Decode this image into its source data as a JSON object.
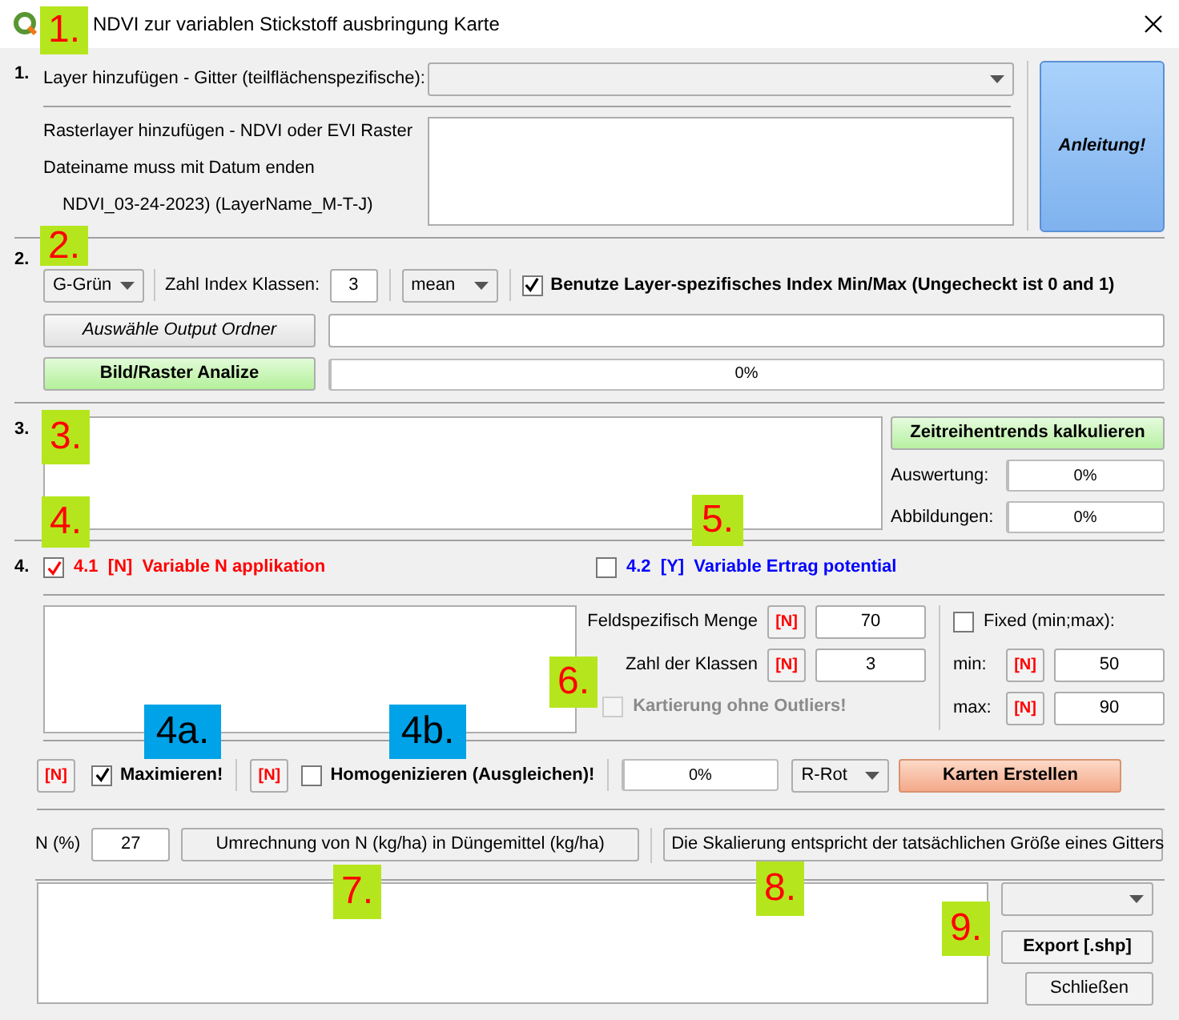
{
  "window": {
    "title": "NDVI zur variablen Stickstoff ausbringung Karte"
  },
  "section1": {
    "number": "1.",
    "layer_label": "Layer hinzufügen - Gitter (teilflächenspezifische):",
    "raster_lines": [
      "Rasterlayer hinzufügen - NDVI oder EVI Raster",
      "Dateiname muss mit Datum enden",
      "NDVI_03-24-2023) (LayerName_M-T-J)"
    ],
    "guide_button": "Anleitung!"
  },
  "section2": {
    "number": "2.",
    "band": "G-Grün",
    "classes_label": "Zahl Index Klassen:",
    "classes": "3",
    "stat": "mean",
    "minmax": {
      "label": "Benutze Layer-spezifisches Index Min/Max (Ungecheckt ist 0 and 1)",
      "checked": true
    },
    "output_button": "Auswähle Output Ordner",
    "analyze_button": "Bild/Raster Analize",
    "progress": {
      "level": 0,
      "reading": "0%"
    }
  },
  "section3": {
    "number": "3.",
    "trend_button": "Zeitreihentrends kalkulieren",
    "rows": [
      {
        "label": "Auswertung:",
        "level": 0,
        "reading": "0%"
      },
      {
        "label": "Abbildungen:",
        "level": 0,
        "reading": "0%"
      }
    ]
  },
  "section4": {
    "number": "4.",
    "options": [
      {
        "code": "4.1",
        "flag": "[N]",
        "label": "Variable N applikation",
        "checked": true,
        "color": "#ff0000"
      },
      {
        "code": "4.2",
        "flag": "[Y]",
        "label": "Variable Ertrag potential",
        "checked": false,
        "color": "#0000ff"
      }
    ],
    "fields": [
      {
        "label": "Feldspezifisch Menge",
        "flag": "[N]",
        "value": "70"
      },
      {
        "label": "Zahl der Klassen",
        "flag": "[N]",
        "value": "3"
      }
    ],
    "outliers": {
      "label": "Kartierung ohne Outliers!",
      "checked": false,
      "disabled": true
    },
    "fixed": {
      "label": "Fixed (min;max):",
      "checked": false
    },
    "limits": [
      {
        "label": "min:",
        "flag": "[N]",
        "value": "50"
      },
      {
        "label": "max:",
        "flag": "[N]",
        "value": "90"
      }
    ],
    "maximize": {
      "flag": "[N]",
      "label": "Maximieren!",
      "checked": true
    },
    "homogenize": {
      "flag": "[N]",
      "label": "Homogenizieren (Ausgleichen)!",
      "checked": false
    },
    "progress": {
      "level": 0,
      "reading": "0%"
    },
    "palette": "R-Rot",
    "create_button": "Karten Erstellen"
  },
  "section5": {
    "n_label": "N (%)",
    "n_value": "27",
    "convert_button": "Umrechnung von N (kg/ha) in Düngemittel (kg/ha)",
    "scale_button": "Die Skalierung entspricht der tatsächlichen Größe eines Gitters"
  },
  "section6": {
    "export_button": "Export [.shp]",
    "close_button": "Schließen"
  },
  "annotations": [
    {
      "label": "1.",
      "kind": "main",
      "color": "#b5e61d"
    },
    {
      "label": "2.",
      "kind": "main",
      "color": "#b5e61d"
    },
    {
      "label": "3.",
      "kind": "main",
      "color": "#b5e61d"
    },
    {
      "label": "4.",
      "kind": "main",
      "color": "#b5e61d"
    },
    {
      "label": "5.",
      "kind": "main",
      "color": "#b5e61d"
    },
    {
      "label": "6.",
      "kind": "main",
      "color": "#b5e61d"
    },
    {
      "label": "4a.",
      "kind": "sub",
      "color": "#00a2e8"
    },
    {
      "label": "4b.",
      "kind": "sub",
      "color": "#00a2e8"
    },
    {
      "label": "7.",
      "kind": "main",
      "color": "#b5e61d"
    },
    {
      "label": "8.",
      "kind": "main",
      "color": "#b5e61d"
    },
    {
      "label": "9.",
      "kind": "main",
      "color": "#b5e61d"
    }
  ]
}
